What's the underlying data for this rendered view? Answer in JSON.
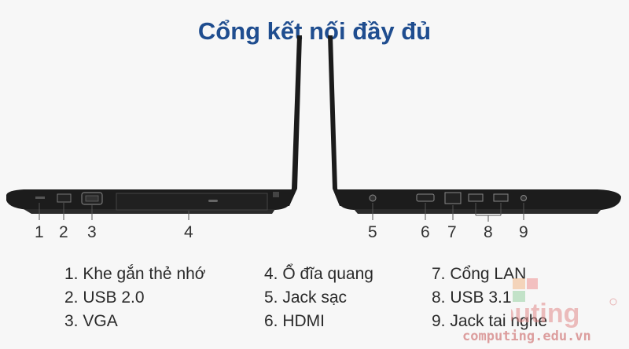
{
  "title": "Cổng kết nối đầy đủ",
  "port_numbers": [
    "1",
    "2",
    "3",
    "4",
    "5",
    "6",
    "7",
    "8",
    "9"
  ],
  "legend": {
    "col1": [
      "1. Khe gắn thẻ nhớ",
      "2. USB 2.0",
      "3. VGA"
    ],
    "col2": [
      "4. Ổ đĩa quang",
      "5. Jack sạc",
      "6. HDMI"
    ],
    "col3": [
      "7. Cổng LAN",
      "8. USB 3.1",
      "9. Jack tai nghe"
    ]
  },
  "watermark": {
    "logo_text": "Computing",
    "url": "computing.edu.vn"
  },
  "colors": {
    "title": "#1f4d8f",
    "laptop_body": "#1a1a1a",
    "watermark": "#e08080"
  }
}
